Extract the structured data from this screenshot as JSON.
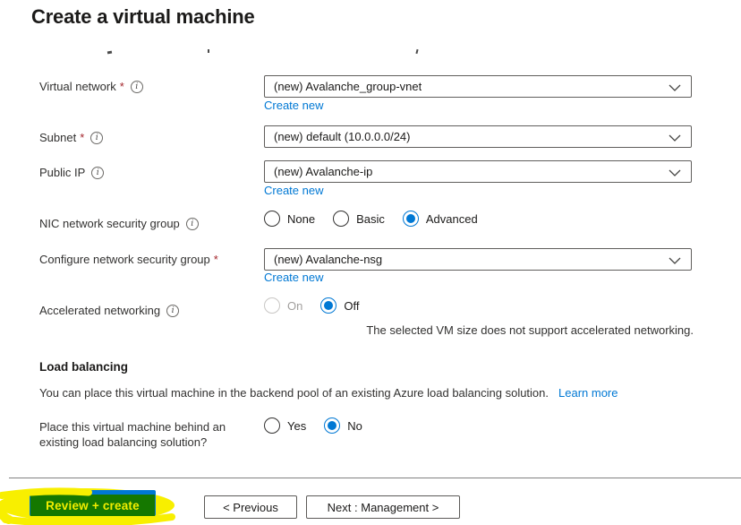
{
  "page": {
    "title": "Create a virtual machine"
  },
  "icons": {
    "info_glyph": "i"
  },
  "links": {
    "create_new": "Create new",
    "learn_more": "Learn more"
  },
  "fields": {
    "virtual_network": {
      "label": "Virtual network",
      "required": "*",
      "value": "(new) Avalanche_group-vnet"
    },
    "subnet": {
      "label": "Subnet",
      "required": "*",
      "value": "(new) default (10.0.0.0/24)"
    },
    "public_ip": {
      "label": "Public IP",
      "value": "(new) Avalanche-ip"
    },
    "nic_nsg": {
      "label": "NIC network security group",
      "options": {
        "none": "None",
        "basic": "Basic",
        "advanced": "Advanced"
      },
      "selected": "Advanced"
    },
    "configure_nsg": {
      "label": "Configure network security group",
      "required": "*",
      "value": "(new) Avalanche-nsg"
    },
    "accelerated_networking": {
      "label": "Accelerated networking",
      "options": {
        "on": "On",
        "off": "Off"
      },
      "selected": "Off",
      "disabled_option": "On",
      "note": "The selected VM size does not support accelerated networking."
    }
  },
  "load_balancing": {
    "heading": "Load balancing",
    "description": "You can place this virtual machine in the backend pool of an existing Azure load balancing solution.",
    "question": "Place this virtual machine behind an existing load balancing solution?",
    "options": {
      "yes": "Yes",
      "no": "No"
    },
    "selected": "No"
  },
  "footer": {
    "review_create": "Review + create",
    "previous": "< Previous",
    "next": "Next : Management >"
  },
  "colors": {
    "accent_blue": "#0078d4",
    "required_asterisk": "#a4262c",
    "field_border": "#605e5c",
    "highlighter_yellow": "#f8ef00",
    "annotated_button_green": "#157800",
    "annotated_button_text": "#f2ee00"
  }
}
